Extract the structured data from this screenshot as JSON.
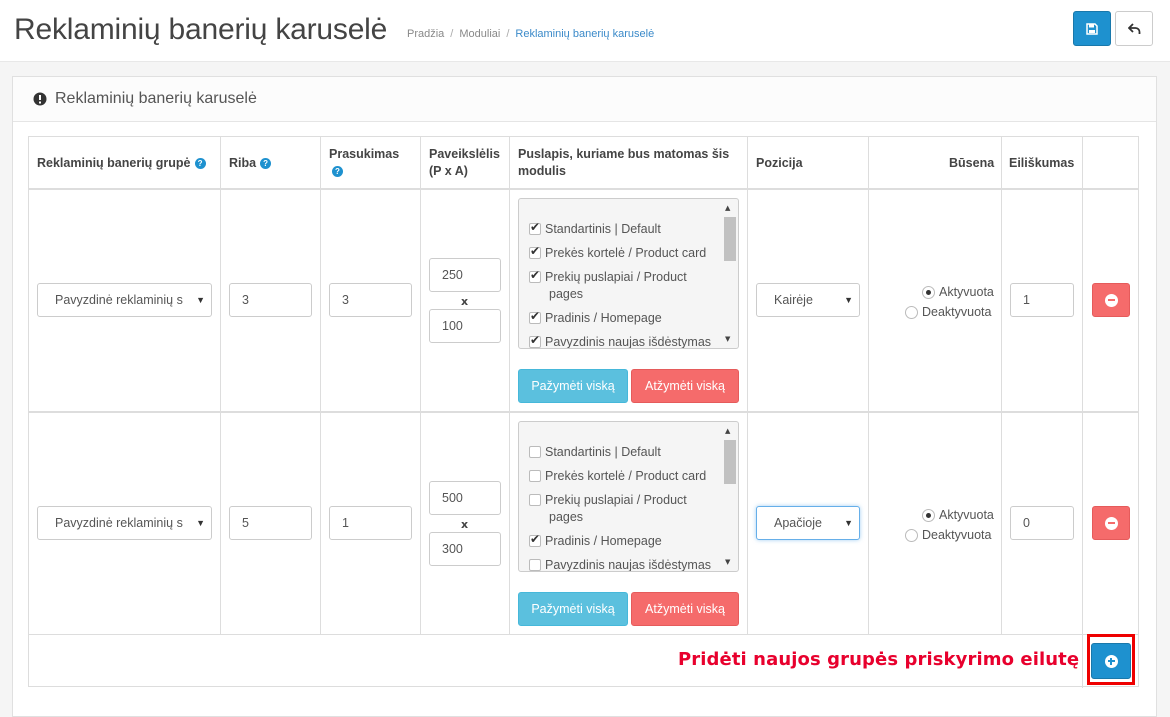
{
  "header": {
    "title": "Reklaminių banerių karuselė",
    "breadcrumb": [
      "Pradžia",
      "Moduliai",
      "Reklaminių banerių karuselė"
    ],
    "breadcrumb_sep": "/",
    "save_icon": "save-icon",
    "back_icon": "back-icon"
  },
  "panel": {
    "heading": "Reklaminių banerių karuselė",
    "heading_icon": "exclamation-circle-icon"
  },
  "table": {
    "headers": {
      "group": "Reklaminių banerių grupė",
      "limit": "Riba",
      "scroll": "Prasukimas",
      "image_line1": "Paveikslėlis",
      "image_line2": "(P x A)",
      "page_line1": "Puslapis, kuriame bus matomas šis",
      "page_line2": "modulis",
      "position": "Pozicija",
      "status": "Būsena",
      "order": "Eiliškumas"
    },
    "help_glyph": "?",
    "x_separator": "x",
    "rows": [
      {
        "group": "Pavyzdinė reklaminių s",
        "limit": "3",
        "scroll": "3",
        "width": "250",
        "height": "100",
        "pages": [
          {
            "label": "Standartinis | Default",
            "checked": true
          },
          {
            "label": "Prekės kortelė / Product card",
            "checked": true
          },
          {
            "label": "Prekių puslapiai / Product",
            "label2": "pages",
            "checked": true
          },
          {
            "label": "Pradinis / Homepage",
            "checked": true
          },
          {
            "label": "Pavyzdinis naujas išdėstymas",
            "checked": true
          }
        ],
        "select_all": "Pažymėti viską",
        "unselect_all": "Atžymėti viską",
        "position": "Kairėje",
        "status_active": "Aktyvuota",
        "status_inactive": "Deaktyvuota",
        "status": "active",
        "order": "1"
      },
      {
        "group": "Pavyzdinė reklaminių s",
        "limit": "5",
        "scroll": "1",
        "width": "500",
        "height": "300",
        "pages": [
          {
            "label": "Standartinis | Default",
            "checked": false
          },
          {
            "label": "Prekės kortelė / Product card",
            "checked": false
          },
          {
            "label": "Prekių puslapiai / Product",
            "label2": "pages",
            "checked": false
          },
          {
            "label": "Pradinis / Homepage",
            "checked": true
          },
          {
            "label": "Pavyzdinis naujas išdėstymas",
            "checked": false
          }
        ],
        "select_all": "Pažymėti viską",
        "unselect_all": "Atžymėti viską",
        "position": "Apačioje",
        "status_active": "Aktyvuota",
        "status_inactive": "Deaktyvuota",
        "status": "active",
        "order": "0"
      }
    ]
  },
  "annotation": "Pridėti naujos grupės priskyrimo eilutę",
  "colors": {
    "primary": "#1e91cf",
    "danger": "#f56b6b",
    "info": "#5bc0de",
    "annotation": "#e8002d"
  }
}
